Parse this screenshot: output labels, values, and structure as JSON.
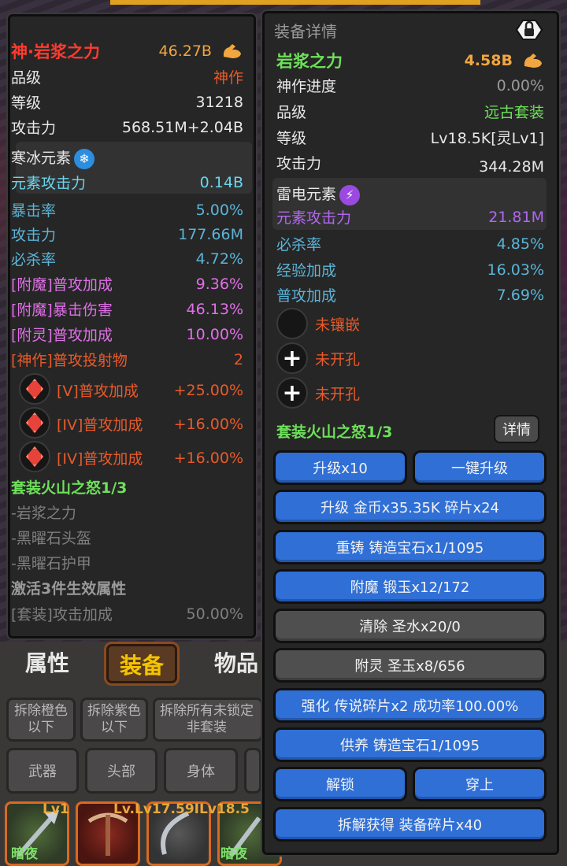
{
  "bottom_nav": {
    "tabs": [
      {
        "label": "属性"
      },
      {
        "label": "装备"
      },
      {
        "label": "物品"
      }
    ]
  },
  "filters": {
    "orange_below": "拆除橙色\n以下",
    "purple_below": "拆除紫色\n以下",
    "unlocked_nonset": "拆除所有未锁定\n非套装"
  },
  "slots": [
    "武器",
    "头部",
    "身体"
  ],
  "item_tiles": [
    {
      "level": "Lv1",
      "name": "暗夜"
    },
    {
      "level": "Lv.Lv17.59ILv18.5",
      "name": ""
    },
    {
      "level": "",
      "name": ""
    },
    {
      "level": "",
      "name": "暗夜"
    }
  ],
  "left_panel": {
    "title": "神·岩浆之力",
    "power": "46.27B",
    "rows": [
      {
        "label": "品级",
        "value": "神作"
      },
      {
        "label": "等级",
        "value": "31218"
      },
      {
        "label": "攻击力",
        "value": "568.51M+2.04B"
      }
    ],
    "element": {
      "name": "寒冰元素",
      "label": "元素攻击力",
      "value": "0.14B"
    },
    "stats": [
      {
        "label": "暴击率",
        "value": "5.00%"
      },
      {
        "label": "攻击力",
        "value": "177.66M"
      },
      {
        "label": "必杀率",
        "value": "4.72%"
      }
    ],
    "enchant_stats": [
      {
        "label": "[附魔]普攻加成",
        "value": "9.36%"
      },
      {
        "label": "[附魔]暴击伤害",
        "value": "46.13%"
      },
      {
        "label": "[附灵]普攻加成",
        "value": "10.00%"
      }
    ],
    "divine_stat": {
      "label": "[神作]普攻投射物",
      "value": "2"
    },
    "gems": [
      {
        "label": "[V]普攻加成",
        "value": "+25.00%"
      },
      {
        "label": "[IV]普攻加成",
        "value": "+16.00%"
      },
      {
        "label": "[IV]普攻加成",
        "value": "+16.00%"
      }
    ],
    "set_title": "套装火山之怒1/3",
    "set_pieces": [
      "-岩浆之力",
      "-黑曜石头盔",
      "-黑曜石护甲"
    ],
    "set_activate": "激活3件生效属性",
    "set_bonus": {
      "label": "[套装]攻击加成",
      "value": "50.00%"
    }
  },
  "right_panel": {
    "header": "装备详情",
    "title": "岩浆之力",
    "power": "4.58B",
    "rows": [
      {
        "label": "神作进度",
        "value": "0.00%"
      },
      {
        "label": "品级",
        "value": "远古套装"
      },
      {
        "label": "等级",
        "value": "Lv18.5K[灵Lv1]"
      },
      {
        "label": "攻击力",
        "value": "344.28M"
      }
    ],
    "element": {
      "name": "雷电元素",
      "label": "元素攻击力",
      "value": "21.81M"
    },
    "stats": [
      {
        "label": "必杀率",
        "value": "4.85%"
      },
      {
        "label": "经验加成",
        "value": "16.03%"
      },
      {
        "label": "普攻加成",
        "value": "7.69%"
      }
    ],
    "sockets": [
      {
        "label": "未镶嵌"
      },
      {
        "label": "未开孔"
      },
      {
        "label": "未开孔"
      }
    ],
    "set_title": "套装火山之怒1/3",
    "detail_button": "详情",
    "buttons": {
      "upgrade10": "升级x10",
      "oneclick": "一键升级",
      "upgrade_cost": "升级 金币x35.35K 碎片x24",
      "recast": "重铸 铸造宝石x1/1095",
      "enchant": "附魔 锻玉x12/172",
      "clear": "清除 圣水x20/0",
      "spirit": "附灵 圣玉x8/656",
      "strengthen": "强化 传说碎片x2 成功率100.00%",
      "nurture": "供养 铸造宝石1/1095",
      "unlock": "解锁",
      "equip": "穿上",
      "dismantle": "拆解获得 装备碎片x40"
    }
  }
}
